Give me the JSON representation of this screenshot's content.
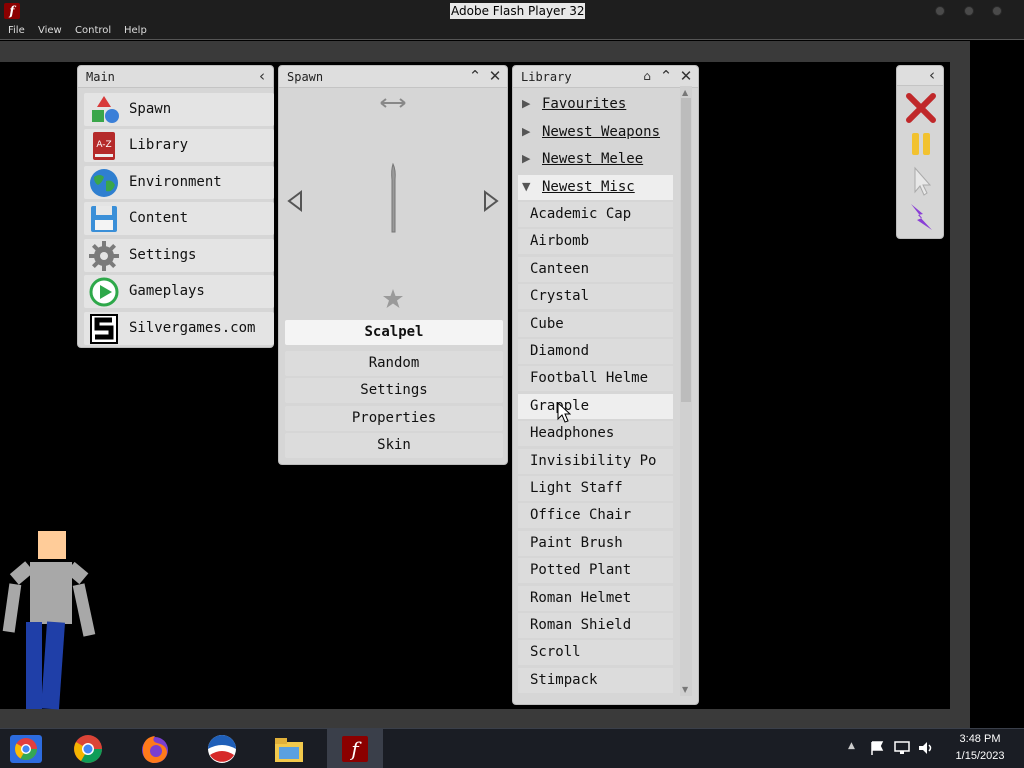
{
  "window": {
    "title": "Adobe Flash Player 32",
    "menu": [
      "File",
      "View",
      "Control",
      "Help"
    ]
  },
  "main_panel": {
    "title": "Main",
    "items": [
      {
        "label": "Spawn",
        "icon": "shapes-icon"
      },
      {
        "label": "Library",
        "icon": "book-icon"
      },
      {
        "label": "Environment",
        "icon": "globe-icon"
      },
      {
        "label": "Content",
        "icon": "floppy-icon"
      },
      {
        "label": "Settings",
        "icon": "gear-icon"
      },
      {
        "label": "Gameplays",
        "icon": "play-icon"
      },
      {
        "label": "Silvergames.com",
        "icon": "silvergames-logo-icon"
      }
    ]
  },
  "spawn_panel": {
    "title": "Spawn",
    "selected": "Scalpel",
    "buttons": [
      "Random",
      "Settings",
      "Properties",
      "Skin"
    ]
  },
  "library_panel": {
    "title": "Library",
    "categories": [
      {
        "label": "Favourites",
        "open": false
      },
      {
        "label": "Newest Weapons",
        "open": false
      },
      {
        "label": "Newest Melee",
        "open": false
      },
      {
        "label": "Newest Misc",
        "open": true
      }
    ],
    "items": [
      "Academic Cap",
      "Airbomb",
      "Canteen",
      "Crystal",
      "Cube",
      "Diamond",
      "Football Helme",
      "Grapple",
      "Headphones",
      "Invisibility Po",
      "Light Staff",
      "Office Chair",
      "Paint Brush",
      "Potted Plant",
      "Roman Helmet",
      "Roman Shield",
      "Scroll",
      "Stimpack"
    ],
    "hovered_item": "Grapple"
  },
  "toolbar": {
    "tools": [
      "close-x-icon",
      "pause-icon",
      "cursor-icon",
      "lightning-icon"
    ]
  },
  "taskbar": {
    "apps": [
      "chrome-icon",
      "firefox-icon",
      "obama-logo-icon",
      "file-explorer-icon",
      "flash-player-icon"
    ],
    "time": "3:48 PM",
    "date": "1/15/2023"
  },
  "colors": {
    "panel_bg": "#d6d6d6",
    "close_red": "#c0282a",
    "pause_yellow": "#f2c230",
    "lightning_purple": "#8a3fd6",
    "char_skin": "#ffcc99",
    "char_shirt": "#a8a8a8",
    "char_pants": "#1f3fa8"
  }
}
